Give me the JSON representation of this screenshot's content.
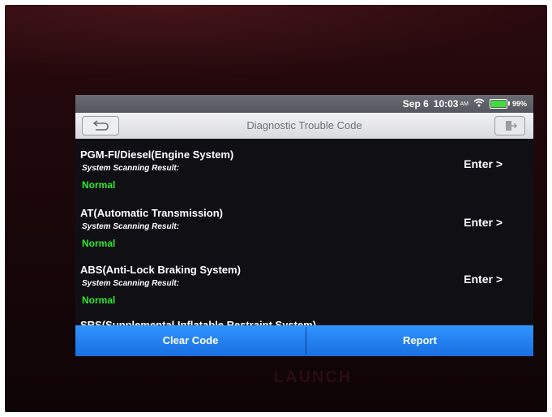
{
  "brand": "LAUNCH",
  "status_bar": {
    "date": "Sep 6",
    "time": "10:03",
    "ampm": "AM",
    "battery_level": 0.99,
    "battery_text": "99%"
  },
  "title_bar": {
    "title": "Diagnostic Trouble Code",
    "back_icon": "back-arrow-icon",
    "exit_icon": "exit-icon"
  },
  "systems": [
    {
      "name": "PGM-FI/Diesel(Engine System)",
      "result_label": "System Scanning Result:",
      "result": "Normal",
      "action": "Enter >"
    },
    {
      "name": "AT(Automatic Transmission)",
      "result_label": "System Scanning Result:",
      "result": "Normal",
      "action": "Enter >"
    },
    {
      "name": "ABS(Anti-Lock Braking System)",
      "result_label": "System Scanning Result:",
      "result": "Normal",
      "action": "Enter >"
    },
    {
      "name": "SRS(Supplemental Inflatable Restraint System)"
    }
  ],
  "actions": {
    "clear_code": "Clear Code",
    "report": "Report"
  },
  "colors": {
    "status_ok": "#2ee82e",
    "accent_blue": "#2f95ff",
    "battery_green": "#3fdc3a"
  }
}
